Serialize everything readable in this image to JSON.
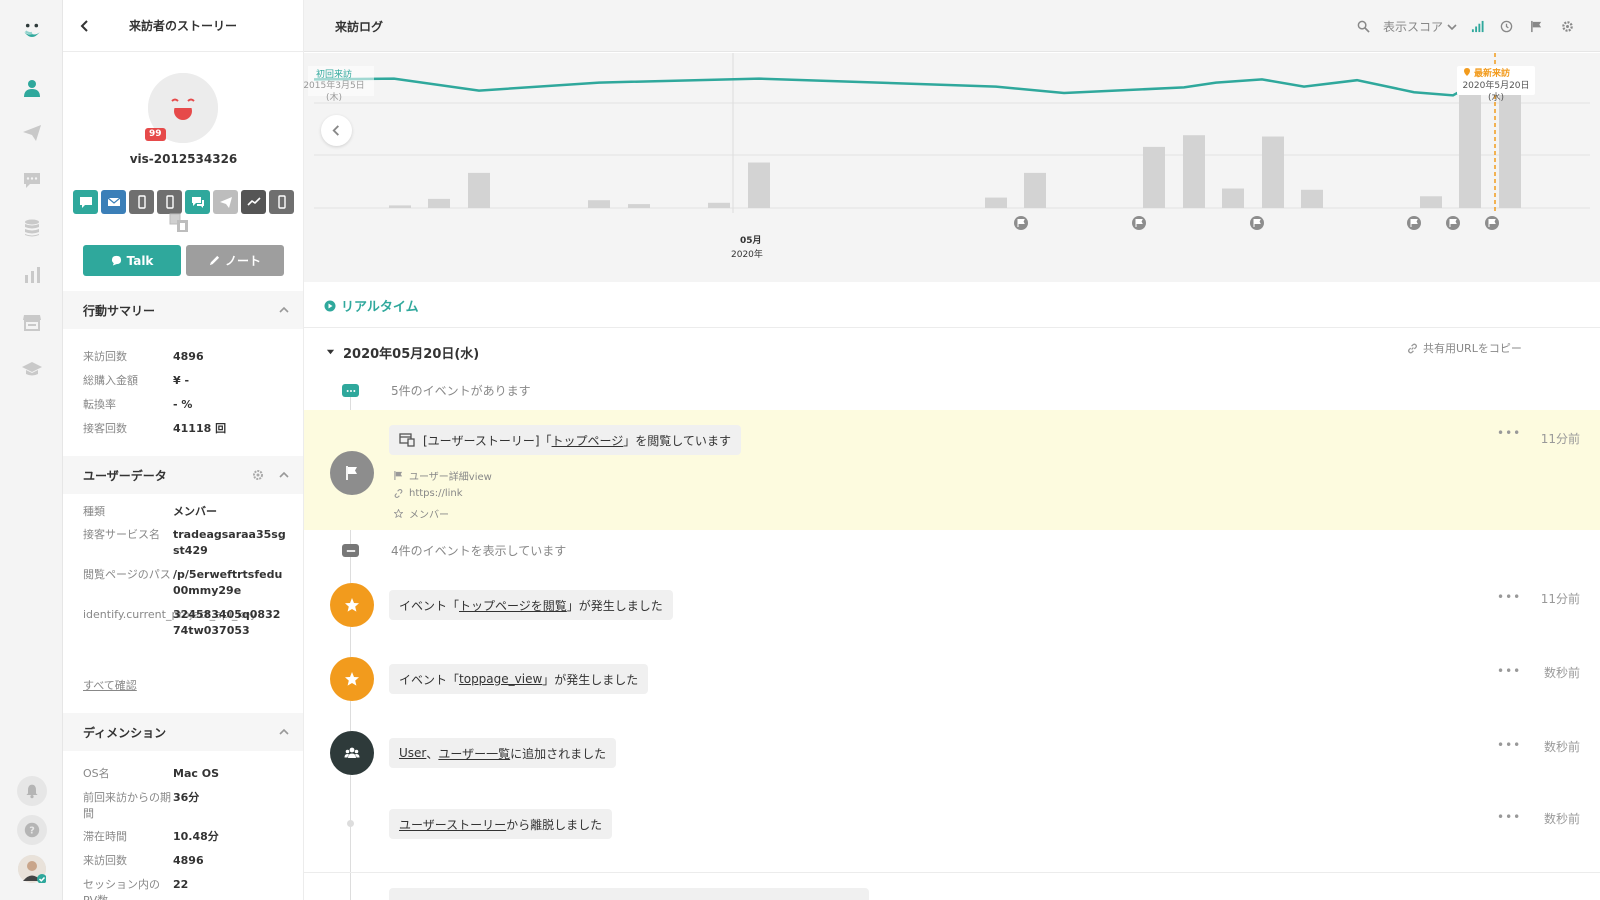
{
  "left_panel": {
    "title": "来訪者のストーリー",
    "badge_count": "99",
    "visitor_id": "vis-2012534326",
    "talk_label": "Talk",
    "note_label": "ノート",
    "behavior_summary": {
      "title": "行動サマリー",
      "rows": [
        {
          "key": "来訪回数",
          "value": "4896"
        },
        {
          "key": "総購入金額",
          "value": "¥ -"
        },
        {
          "key": "転換率",
          "value": "- %"
        },
        {
          "key": "接客回数",
          "value": "41118 回"
        }
      ]
    },
    "user_data": {
      "title": "ユーザーデータ",
      "rows": [
        {
          "key": "種類",
          "value": "メンバー"
        },
        {
          "key": "接客サービス名",
          "value": "tradeagsaraa35sgst429"
        },
        {
          "key": "閲覧ページのパス",
          "value": "/p/5erweftrtsfedu00mmy29e"
        },
        {
          "key": "identify.current_project_api_key",
          "value": "324583405q083274tw037053"
        }
      ],
      "see_all": "すべて確認"
    },
    "dimension": {
      "title": "ディメンション",
      "rows": [
        {
          "key": "OS名",
          "value": "Mac OS"
        },
        {
          "key": "前回来訪からの期間",
          "value": "36分"
        },
        {
          "key": "滞在時間",
          "value": "10.48分"
        },
        {
          "key": "来訪回数",
          "value": "4896"
        },
        {
          "key": "セッション内のPV数",
          "value": "22"
        }
      ]
    }
  },
  "topbar": {
    "title": "来訪ログ",
    "score_label": "表示スコア"
  },
  "chart_data": {
    "type": "line",
    "first_visit_label": "初回来訪",
    "first_visit_date": "2015年3月5日",
    "first_visit_dow": "(木)",
    "latest_visit_label": "最新来訪",
    "latest_visit_date": "2020年5月20日",
    "latest_visit_dow": "(水)",
    "month_label": "05月",
    "year_label": "2020年",
    "line_values": [
      0.92,
      0.93,
      0.78,
      0.88,
      0.93,
      0.83,
      0.75,
      0.82,
      0.88,
      0.92,
      0.83,
      0.91,
      0.76,
      0.72,
      0.99
    ],
    "bar_values": [
      0.02,
      0.07,
      0.27,
      0.06,
      0.03,
      0.04,
      0.35,
      0.08,
      0.27,
      0.47,
      0.56,
      0.15,
      0.55,
      0.14,
      0.09,
      1.0,
      1.0
    ],
    "grid": true
  },
  "realtime": {
    "label": "リアルタイム"
  },
  "timeline": {
    "date": "2020年05月20日(水)",
    "share_url_label": "共有用URLをコピー",
    "summary_top": "5件のイベントがあります",
    "summary_shown": "4件のイベントを表示しています",
    "highlight_event": {
      "prefix": "[ユーザーストーリー]「",
      "link": "トップページ",
      "suffix": "」を閲覧しています",
      "time": "11分前",
      "meta_view": "ユーザー詳細view",
      "meta_link": "https://link",
      "meta_member": "メンバー"
    },
    "events": [
      {
        "prefix": "イベント「",
        "link": "トップページを閲覧",
        "suffix": "」が発生しました",
        "time": "11分前"
      },
      {
        "prefix": "イベント「",
        "link": "toppage_view",
        "suffix": "」が発生しました",
        "time": "数秒前"
      },
      {
        "link1": "User",
        "sep": "、",
        "link2": "ユーザー一覧",
        "suffix": "に追加されました",
        "time": "数秒前"
      },
      {
        "link": "ユーザーストーリー",
        "suffix": "から離脱しました",
        "time": "数秒前"
      }
    ],
    "more_label": "•••"
  },
  "colors": {
    "accent": "#2fa89c",
    "event_orange": "#f29b1d",
    "flag_gray": "#8d8d8d",
    "group_dark": "#2e3a3a",
    "highlight_bg": "#fdfbdf"
  }
}
